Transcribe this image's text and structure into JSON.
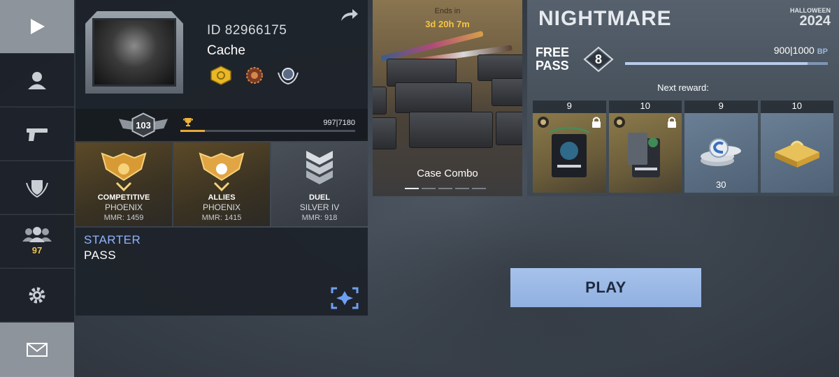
{
  "sidebar": {
    "friends_count": "97"
  },
  "profile": {
    "player_id": "ID 82966175",
    "player_name": "Cache",
    "level": "103",
    "xp_text": "997|7180",
    "xp_progress": 0.139
  },
  "ranks": [
    {
      "mode": "COMPETITIVE",
      "name": "PHOENIX",
      "mmr": "MMR: 1459"
    },
    {
      "mode": "ALLIES",
      "name": "PHOENIX",
      "mmr": "MMR: 1415"
    },
    {
      "mode": "DUEL",
      "name": "SILVER IV",
      "mmr": "MMR: 918"
    }
  ],
  "starter_pass": {
    "title": "STARTER",
    "subtitle": "PASS"
  },
  "case_combo": {
    "ends_label": "Ends in",
    "timer": "3d 20h 7m",
    "label": "Case Combo"
  },
  "event_pass": {
    "title": "NIGHTMARE",
    "event_name": "HALLOWEEN",
    "event_year": "2024",
    "pass_type": "FREE PASS",
    "pass_level": "8",
    "bp_text": "900|1000",
    "bp_unit": "BP",
    "bp_progress": 0.9,
    "next_reward_label": "Next reward:",
    "rewards": [
      {
        "level": "9",
        "qty": ""
      },
      {
        "level": "10",
        "qty": ""
      },
      {
        "level": "9",
        "qty": "30"
      },
      {
        "level": "10",
        "qty": ""
      }
    ]
  },
  "play_button": "PLAY",
  "colors": {
    "accent_blue": "#91b0e0",
    "gold": "#f4c542",
    "starter_blue": "#8fb3ff"
  }
}
